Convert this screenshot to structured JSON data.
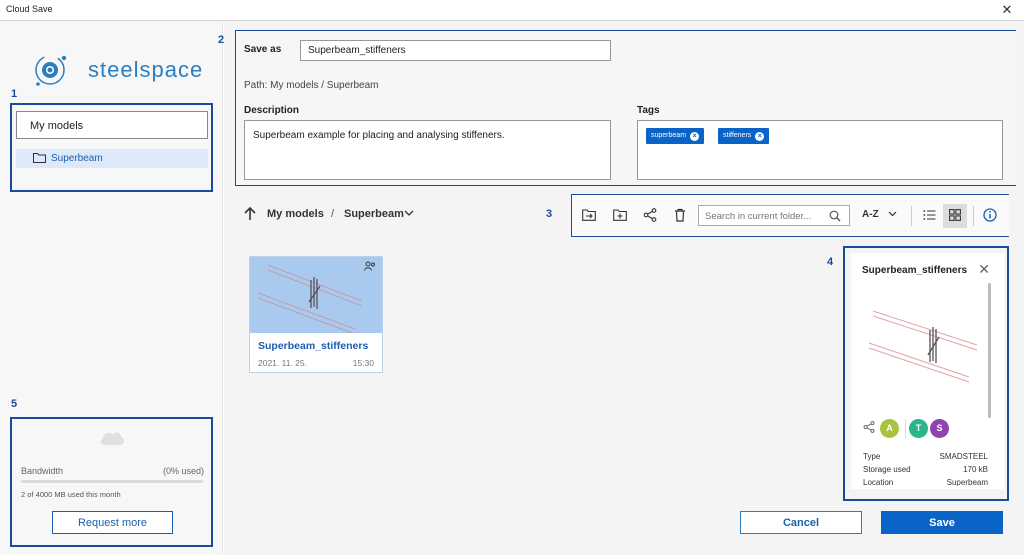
{
  "window": {
    "title": "Cloud Save",
    "close_glyph": "✕"
  },
  "brand": {
    "name": "steelspace"
  },
  "callouts": [
    "1",
    "2",
    "3",
    "4",
    "5"
  ],
  "tree": {
    "root_label": "My models",
    "items": [
      {
        "label": "Superbeam",
        "icon": "folder-icon"
      }
    ]
  },
  "bandwidth": {
    "label": "Bandwidth",
    "percent_text": "(0% used)",
    "used_fraction": 0.0,
    "usage_text": "2 of 4000 MB used this month",
    "request_label": "Request more"
  },
  "form": {
    "save_as_label": "Save as",
    "save_as_value": "Superbeam_stiffeners",
    "path_text": "Path: My models / Superbeam",
    "description_label": "Description",
    "description_value": "Superbeam example for placing and analysing stiffeners.",
    "tags_label": "Tags",
    "tags": [
      "superbeam",
      "stiffeners"
    ]
  },
  "breadcrumb": {
    "root": "My models",
    "separator": "/",
    "current": "Superbeam"
  },
  "toolbar": {
    "search_placeholder": "Search in current folder...",
    "sort_label": "A-Z",
    "icons": [
      "move-to-folder-icon",
      "new-folder-icon",
      "share-icon",
      "delete-icon",
      "search-icon",
      "list-view-icon",
      "grid-view-icon",
      "info-icon"
    ]
  },
  "files": [
    {
      "name": "Superbeam_stiffeners",
      "date": "2021. 11. 25.",
      "time": "15:30",
      "shared": true
    }
  ],
  "details": {
    "title": "Superbeam_stiffeners",
    "avatars": [
      {
        "letter": "A",
        "color": "#a9c23f"
      },
      {
        "letter": "T",
        "color": "#2bb58a"
      },
      {
        "letter": "S",
        "color": "#8e44ad"
      }
    ],
    "properties": [
      {
        "key": "Type",
        "value": "SMADSTEEL"
      },
      {
        "key": "Storage used",
        "value": "170 kB"
      },
      {
        "key": "Location",
        "value": "Superbeam"
      }
    ]
  },
  "actions": {
    "cancel_label": "Cancel",
    "save_label": "Save"
  },
  "colors": {
    "accent": "#0a63c7",
    "annotation": "#1b4b9c",
    "selected_row": "#dde8f8",
    "thumb_bg": "#a9c9ee"
  }
}
